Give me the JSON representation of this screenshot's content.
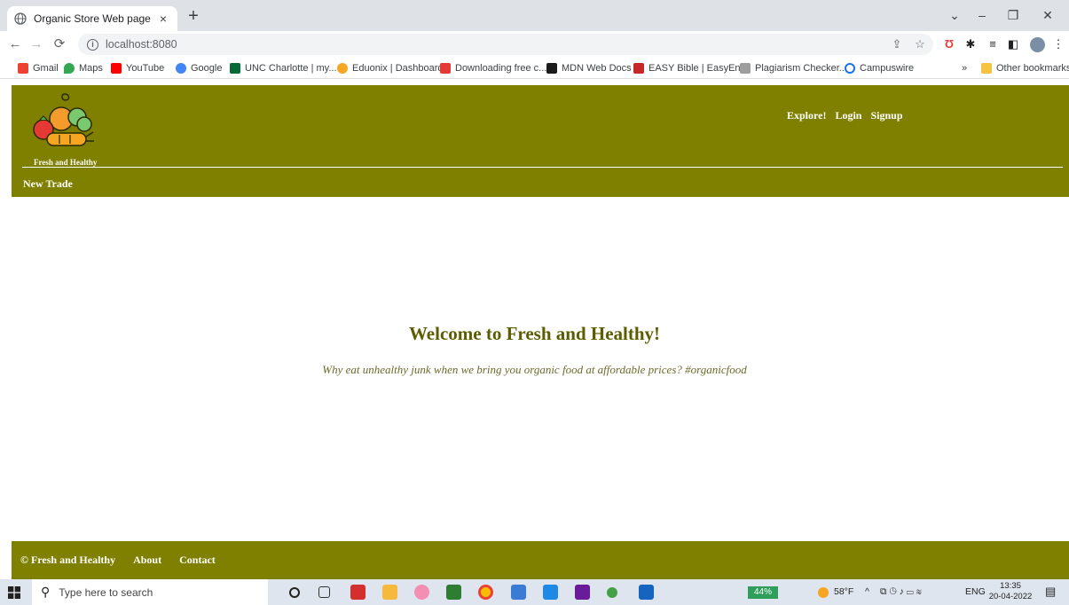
{
  "browser": {
    "tab_title": "Organic Store Web page",
    "tab_close": "×",
    "new_tab": "+",
    "url": "localhost:8080",
    "window_controls": {
      "dropdown": "⌄",
      "minimize": "–",
      "restore": "❐",
      "close": "✕"
    }
  },
  "bookmarks": [
    {
      "label": "Gmail",
      "color": "#ea4335"
    },
    {
      "label": "Maps",
      "color": "#34a853"
    },
    {
      "label": "YouTube",
      "color": "#ff0000"
    },
    {
      "label": "Google",
      "color": "#4285f4"
    },
    {
      "label": "UNC Charlotte | my...",
      "color": "#046a38"
    },
    {
      "label": "Eduonix | Dashboard",
      "color": "#f5a623"
    },
    {
      "label": "Downloading free c...",
      "color": "#e53935"
    },
    {
      "label": "MDN Web Docs",
      "color": "#1b1b1b"
    },
    {
      "label": "EASY Bible | EasyEn...",
      "color": "#c62828"
    },
    {
      "label": "Plagiarism Checker...",
      "color": "#9e9e9e"
    },
    {
      "label": "Campuswire",
      "color": "#1a73e8"
    }
  ],
  "bookmarks_overflow": "»",
  "other_bookmarks": "Other bookmarks",
  "site": {
    "logo_caption": "Fresh and Healthy",
    "nav": [
      "Explore!",
      "Login",
      "Signup"
    ],
    "new_trade": "New Trade",
    "hero_title": "Welcome to Fresh and Healthy!",
    "hero_tagline": "Why eat unhealthy junk when we bring you organic food at affordable prices? #organicfood",
    "footer_links": [
      "© Fresh and Healthy",
      "About",
      "Contact"
    ],
    "brand_color": "#808000"
  },
  "taskbar": {
    "search_placeholder": "Type here to search",
    "battery": "44%",
    "weather": "58°F",
    "language": "ENG",
    "time": "13:35",
    "date": "20-04-2022"
  }
}
